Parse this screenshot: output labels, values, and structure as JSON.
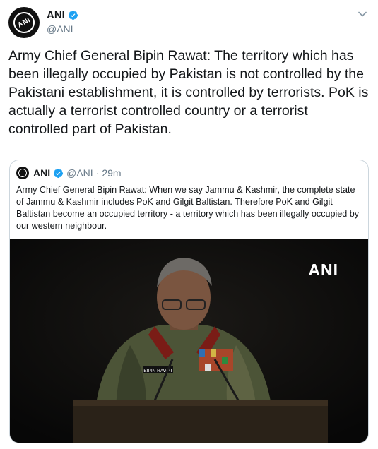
{
  "tweet": {
    "author": {
      "name": "ANI",
      "handle": "@ANI",
      "verified": true,
      "avatar_text": "ANI"
    },
    "text": "Army Chief General Bipin Rawat: The territory which has been illegally occupied by Pakistan is not controlled by the Pakistani establishment, it is controlled by terrorists. PoK is actually a terrorist controlled country or a terrorist controlled part of Pakistan."
  },
  "quoted_tweet": {
    "author": {
      "name": "ANI",
      "handle": "@ANI",
      "verified": true
    },
    "separator": "·",
    "time": "29m",
    "text": "Army Chief General Bipin Rawat: When we say Jammu & Kashmir, the complete state of Jammu & Kashmir includes PoK and Gilgit Baltistan. Therefore PoK and Gilgit Baltistan become an occupied territory - a territory which has been illegally occupied by our western neighbour.",
    "media": {
      "watermark": "ANI",
      "name_tag": "BIPIN RAWAT"
    }
  },
  "colors": {
    "text": "#14171a",
    "secondary": "#657786",
    "verified": "#1da1f2",
    "border": "#ccd6dd"
  },
  "icons": [
    "verified-badge-icon",
    "chevron-down-icon"
  ]
}
